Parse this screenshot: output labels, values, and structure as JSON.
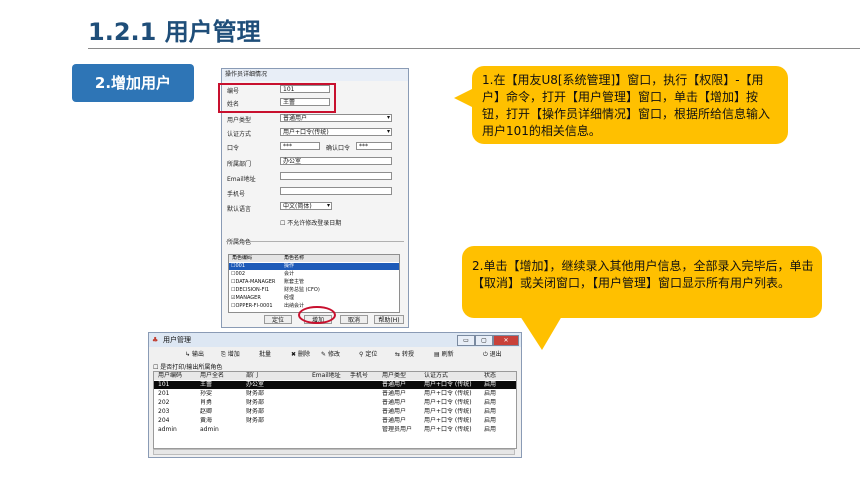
{
  "page": {
    "title": "1.2.1 用户管理",
    "section_tag": "2.增加用户"
  },
  "operator_dialog": {
    "title": "操作员详细情况",
    "fields": {
      "code": {
        "label": "编号",
        "value": "101"
      },
      "name": {
        "label": "姓名",
        "value": "王蕾"
      },
      "user_type": {
        "label": "用户类型",
        "value": "普通用户"
      },
      "auth_method": {
        "label": "认证方式",
        "value": "用户+口令(传统)"
      },
      "password": {
        "label": "口令",
        "value": "***"
      },
      "confirm_password": {
        "label": "确认口令",
        "value": "***"
      },
      "department": {
        "label": "所属部门",
        "value": "办公室"
      },
      "email": {
        "label": "Email地址",
        "value": ""
      },
      "phone": {
        "label": "手机号",
        "value": ""
      },
      "language": {
        "label": "默认语言",
        "value": "中文(简体)"
      }
    },
    "no_modify_login_date": "不允许修改登录日期",
    "roles_section_label": "所属角色",
    "role_headers": [
      "角色编码",
      "角色名称"
    ],
    "roles": [
      {
        "code": "001",
        "name": "操作",
        "checked": false,
        "selected": true
      },
      {
        "code": "002",
        "name": "会计",
        "checked": false,
        "selected": false
      },
      {
        "code": "DATA-MANAGER",
        "name": "账套主管",
        "checked": false,
        "selected": false
      },
      {
        "code": "DECISION-FI1",
        "name": "财务总监 (CFO)",
        "checked": false,
        "selected": false
      },
      {
        "code": "MANAGER",
        "name": "经理",
        "checked": true,
        "selected": false
      },
      {
        "code": "OPPER-FI-0001",
        "name": "出纳会计",
        "checked": false,
        "selected": false
      }
    ],
    "buttons": {
      "locate": "定位",
      "add": "增加",
      "cancel": "取消",
      "help": "帮助(H)"
    }
  },
  "callout1": "1.在【用友U8[系统管理]】窗口，执行【权限】-【用户】命令，打开【用户管理】窗口，单击【增加】按钮，打开【操作员详细情况】窗口，根据所给信息输入用户101的相关信息。",
  "callout2": "2.单击【增加】，继续录入其他用户信息，全部录入完毕后，单击【取消】或关闭窗口，【用户管理】窗口显示所有用户列表。",
  "user_window": {
    "title": "用户管理",
    "toolbar": [
      "输出",
      "增加",
      "批量",
      "删除",
      "修改",
      "定位",
      "转授",
      "刷新",
      "退出"
    ],
    "print_checkbox": "是否打印/输出所属角色",
    "headers": [
      "用户编码",
      "用户全名",
      "部门",
      "Email地址",
      "手机号",
      "用户类型",
      "认证方式",
      "状态"
    ],
    "rows": [
      [
        "101",
        "王蕾",
        "办公室",
        "",
        "",
        "普通用户",
        "用户+口令 (传统)",
        "启用"
      ],
      [
        "201",
        "孙雯",
        "财务部",
        "",
        "",
        "普通用户",
        "用户+口令 (传统)",
        "启用"
      ],
      [
        "202",
        "肖勇",
        "财务部",
        "",
        "",
        "普通用户",
        "用户+口令 (传统)",
        "启用"
      ],
      [
        "203",
        "赵卿",
        "财务部",
        "",
        "",
        "普通用户",
        "用户+口令 (传统)",
        "启用"
      ],
      [
        "204",
        "黄海",
        "财务部",
        "",
        "",
        "普通用户",
        "用户+口令 (传统)",
        "启用"
      ],
      [
        "admin",
        "admin",
        "",
        "",
        "",
        "管理员用户",
        "用户+口令 (传统)",
        "启用"
      ]
    ]
  },
  "colors": {
    "title": "#1f4e79",
    "tag_bg": "#2e75b6",
    "callout_bg": "#ffc000",
    "highlight": "#c8102e"
  }
}
